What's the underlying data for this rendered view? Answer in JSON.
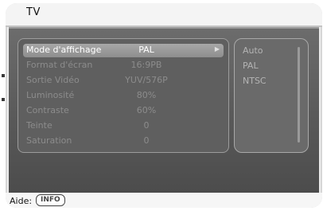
{
  "window": {
    "title": "TV"
  },
  "settings": [
    {
      "label": "Mode d'affichage",
      "value": "PAL",
      "selected": true
    },
    {
      "label": "Format d'écran",
      "value": "16:9PB"
    },
    {
      "label": "Sortie Vidéo",
      "value": "YUV/576P"
    },
    {
      "label": "Luminosité",
      "value": "80%"
    },
    {
      "label": "Contraste",
      "value": "60%"
    },
    {
      "label": "Teinte",
      "value": "0"
    },
    {
      "label": "Saturation",
      "value": "0"
    }
  ],
  "options": [
    "Auto",
    "PAL",
    "NTSC"
  ],
  "help": {
    "label": "Aide:",
    "key": "INFO"
  },
  "icons": {
    "submenu": "arrow-right-icon"
  }
}
